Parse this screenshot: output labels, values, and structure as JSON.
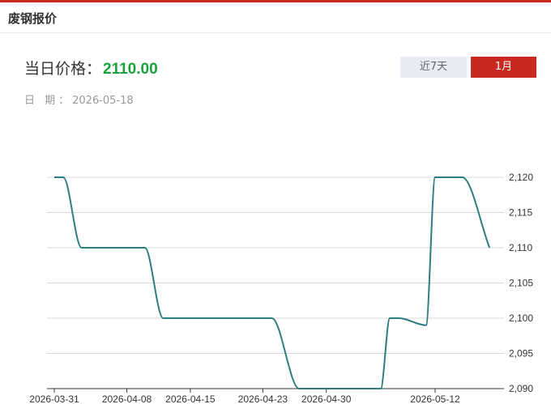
{
  "header": {
    "title": "废钢报价"
  },
  "price": {
    "label": "当日价格：",
    "value": "2110.00"
  },
  "date": {
    "label": "日 期：",
    "value": "2026-05-18"
  },
  "range_buttons": [
    {
      "label": "近7天",
      "active": false
    },
    {
      "label": "1月",
      "active": true
    }
  ],
  "colors": {
    "accent": "#c8281f",
    "price_green": "#19a33a",
    "line": "#2e7d82"
  },
  "chart_data": {
    "type": "line",
    "ylim": [
      2090,
      2120
    ],
    "y_ticks": [
      "2,120",
      "2,115",
      "2,110",
      "2,105",
      "2,100",
      "2,095",
      "2,090"
    ],
    "y_tick_values": [
      2120,
      2115,
      2110,
      2105,
      2100,
      2095,
      2090
    ],
    "x_tick_labels": [
      "2026-03-31",
      "2026-04-08",
      "2026-04-15",
      "2026-04-23",
      "2026-04-30",
      "2026-05-12"
    ],
    "x_tick_dates": [
      "2026-03-31",
      "2026-04-08",
      "2026-04-15",
      "2026-04-23",
      "2026-04-30",
      "2026-05-12"
    ],
    "grid": true,
    "series": [
      {
        "x": [
          "2026-03-31",
          "2026-04-01",
          "2026-04-03",
          "2026-04-04",
          "2026-04-05",
          "2026-04-06",
          "2026-04-07",
          "2026-04-08",
          "2026-04-09",
          "2026-04-10",
          "2026-04-12",
          "2026-04-13",
          "2026-04-14",
          "2026-04-15",
          "2026-04-16",
          "2026-04-17",
          "2026-04-20",
          "2026-04-21",
          "2026-04-22",
          "2026-04-23",
          "2026-04-24",
          "2026-04-27",
          "2026-04-28",
          "2026-04-29",
          "2026-04-30",
          "2026-05-06",
          "2026-05-07",
          "2026-05-08",
          "2026-05-11",
          "2026-05-12",
          "2026-05-13",
          "2026-05-14",
          "2026-05-15",
          "2026-05-18"
        ],
        "y": [
          2120,
          2120,
          2110,
          2110,
          2110,
          2110,
          2110,
          2110,
          2110,
          2110,
          2100,
          2100,
          2100,
          2100,
          2100,
          2100,
          2100,
          2100,
          2100,
          2100,
          2100,
          2090,
          2090,
          2090,
          2090,
          2090,
          2100,
          2100,
          2099,
          2120,
          2120,
          2120,
          2120,
          2110
        ]
      }
    ]
  }
}
